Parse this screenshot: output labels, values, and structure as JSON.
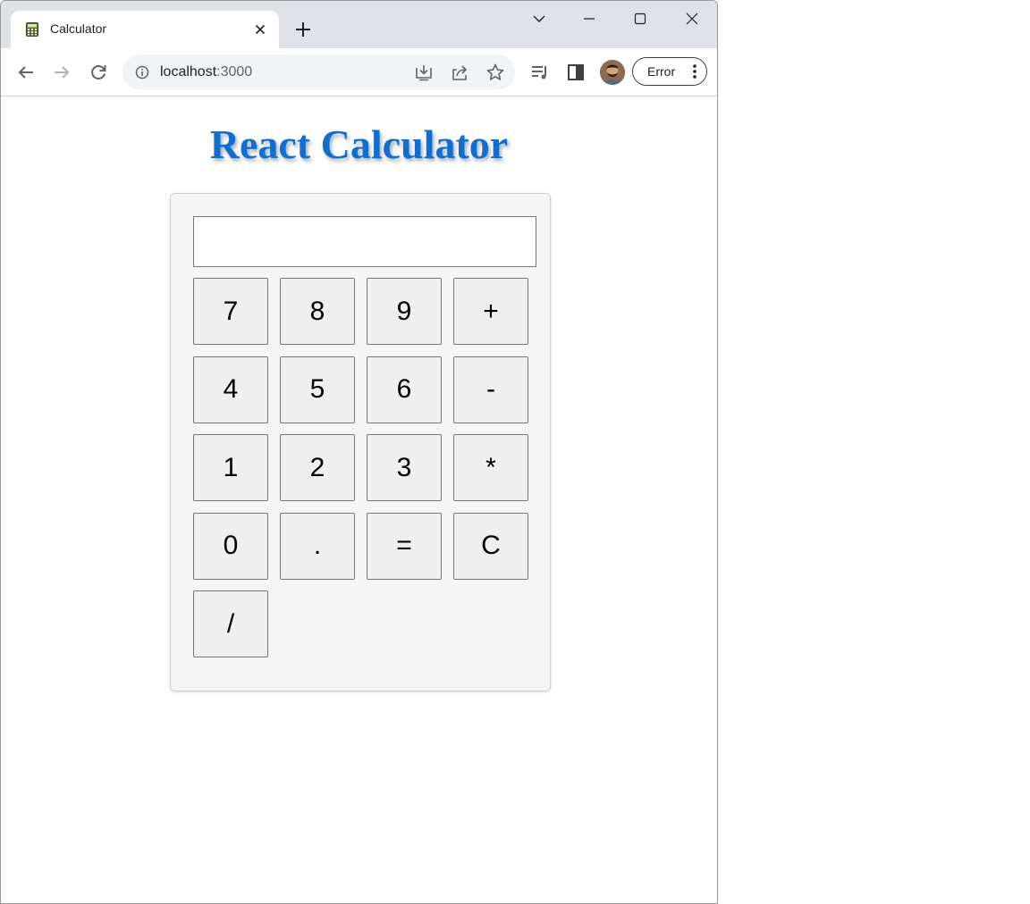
{
  "browser": {
    "tab_title": "Calculator",
    "url_host": "localhost",
    "url_port": ":3000",
    "profile_button_label": "Error"
  },
  "page": {
    "heading": "React Calculator",
    "heading_color": "#0d6fd1"
  },
  "calculator": {
    "display_value": "",
    "rows": [
      [
        "7",
        "8",
        "9",
        "+"
      ],
      [
        "4",
        "5",
        "6",
        "-"
      ],
      [
        "1",
        "2",
        "3",
        "*"
      ],
      [
        "0",
        ".",
        "=",
        "C"
      ],
      [
        "/"
      ]
    ]
  },
  "icons": [
    "calculator-favicon",
    "close-icon",
    "plus-icon",
    "chevron-down-icon",
    "minimize-icon",
    "maximize-icon",
    "window-close-icon",
    "back-arrow-icon",
    "forward-arrow-icon",
    "reload-icon",
    "info-icon",
    "install-icon",
    "share-icon",
    "star-icon",
    "reading-list-icon",
    "side-panel-icon",
    "more-vert-icon"
  ]
}
